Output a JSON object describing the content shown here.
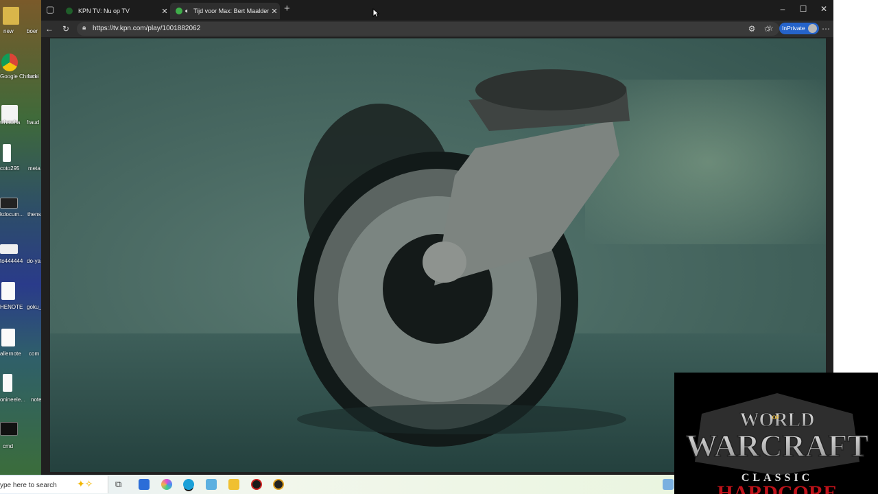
{
  "desktop": {
    "icons": [
      {
        "label": "new",
        "label2": "boer"
      },
      {
        "label": "Google Chrome",
        "label2": "fucki"
      },
      {
        "label": "whawha",
        "label2": "fraud"
      },
      {
        "label": "coto295",
        "label2": "meta"
      },
      {
        "label": "kdocum...",
        "label2": "thens"
      },
      {
        "label": "to444444",
        "label2": "do-ya"
      },
      {
        "label": "HENOTE",
        "label2": "goku_"
      },
      {
        "label": "allernote",
        "label2": "com"
      },
      {
        "label": "onineele...",
        "label2": "note"
      },
      {
        "label": "cmd",
        "label2": ""
      }
    ]
  },
  "browser": {
    "tabs": [
      {
        "title": "KPN TV: Nu op TV",
        "active": false
      },
      {
        "title": "Tijd voor Max: Bert Maalderi",
        "active": true
      }
    ],
    "new_tab": "+",
    "window_controls": {
      "minimize": "–",
      "maximize": "☐",
      "close": "✕"
    },
    "address_bar": {
      "url": "https://tv.kpn.com/play/1001882062"
    },
    "inprivate_label": "InPrivate"
  },
  "overlay": {
    "line1": "WORLD",
    "of": "OF",
    "line2": "WARCRAFT",
    "line3": "CLASSIC",
    "line4": "HARDCORE"
  },
  "taskbar": {
    "search_placeholder": "ype here to search"
  },
  "colors": {
    "accent": "#2563c9",
    "video_tint": "#4a6a63"
  }
}
